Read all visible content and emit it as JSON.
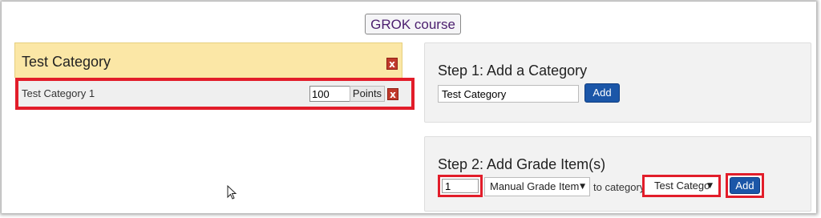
{
  "course": {
    "title": "GROK course"
  },
  "categories": [
    {
      "name": "Test Category",
      "remove_glyph": "x",
      "items": [
        {
          "name": "Test Category 1",
          "points_value": "100",
          "points_label": "Points",
          "remove_glyph": "x"
        }
      ]
    }
  ],
  "step1": {
    "title": "Step 1: Add a Category",
    "input_value": "Test Category",
    "add_label": "Add"
  },
  "step2": {
    "title": "Step 2: Add Grade Item(s)",
    "quantity_value": "1",
    "item_type_selected": "Manual Grade Item",
    "to_category_label": "to category",
    "category_selected": "Test Catego",
    "add_label": "Add"
  },
  "colors": {
    "highlight": "#e21d2a",
    "primary_button": "#1b56a8",
    "category_header": "#fbe7a6",
    "remove_button": "#c0392b",
    "course_title_text": "#4b1e6e"
  },
  "icons": {
    "remove": "close-icon",
    "cursor": "mouse-pointer-icon",
    "dropdown": "chevron-down-icon"
  }
}
